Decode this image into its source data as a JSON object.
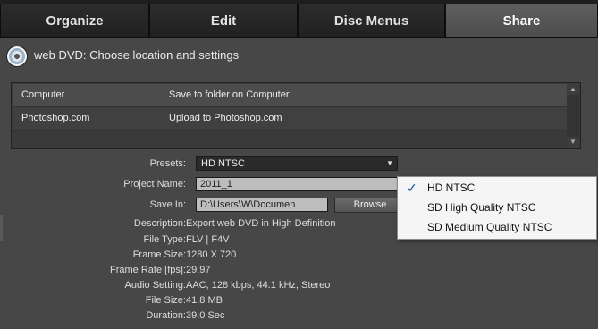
{
  "tabs": [
    {
      "label": "Organize"
    },
    {
      "label": "Edit"
    },
    {
      "label": "Disc Menus"
    },
    {
      "label": "Share",
      "active": true
    }
  ],
  "header": {
    "title": "web DVD: Choose location and settings",
    "icon": "disc-icon"
  },
  "locations": [
    {
      "name": "Computer",
      "action": "Save to folder on Computer"
    },
    {
      "name": "Photoshop.com",
      "action": "Upload to Photoshop.com"
    }
  ],
  "form": {
    "presets_label": "Presets:",
    "presets_value": "HD NTSC",
    "project_name_label": "Project Name:",
    "project_name_value": "2011_1",
    "save_in_label": "Save In:",
    "save_in_value": "D:\\Users\\W\\Documen",
    "browse_label": "Browse",
    "description_label": "Description:",
    "description_value": "Export web DVD in High Definition",
    "file_type_label": "File Type:",
    "file_type_value": "FLV | F4V",
    "frame_size_label": "Frame Size:",
    "frame_size_value": "1280 X 720",
    "frame_rate_label": "Frame Rate [fps]:",
    "frame_rate_value": "29.97",
    "audio_label": "Audio Setting:",
    "audio_value": "AAC, 128 kbps, 44.1 kHz, Stereo",
    "file_size_label": "File Size:",
    "file_size_value": "41.8 MB",
    "duration_label": "Duration:",
    "duration_value": "39.0 Sec"
  },
  "preset_dropdown": {
    "options": [
      {
        "label": "HD NTSC",
        "checked": true
      },
      {
        "label": "SD High Quality NTSC"
      },
      {
        "label": "SD Medium Quality NTSC"
      }
    ],
    "check_glyph": "✓"
  },
  "colors": {
    "panel_bg": "#474747",
    "tab_active": "#555555",
    "menu_bg": "#f5f5f5"
  }
}
